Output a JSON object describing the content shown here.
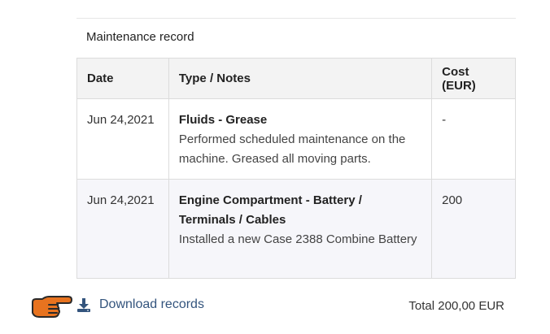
{
  "section": {
    "title": "Maintenance record"
  },
  "table": {
    "headers": {
      "date": "Date",
      "type": "Type / Notes",
      "cost": "Cost (EUR)"
    },
    "rows": [
      {
        "date": "Jun 24,2021",
        "type": "Fluids - Grease",
        "notes": "Performed scheduled maintenance on the machine. Greased all moving parts.",
        "cost": "-"
      },
      {
        "date": "Jun 24,2021",
        "type": "Engine Compartment - Battery / Terminals / Cables",
        "notes": "Installed a new Case 2388 Combine Battery",
        "cost": "200"
      }
    ]
  },
  "footer": {
    "download_label": "Download records",
    "total": "Total 200,00 EUR"
  },
  "icons": {
    "pointer": "pointing-hand-icon",
    "download": "download-icon"
  },
  "colors": {
    "link": "#33547d",
    "hand": "#e8731f",
    "header_bg": "#f3f3f3",
    "alt_row_bg": "#f6f6fa"
  }
}
